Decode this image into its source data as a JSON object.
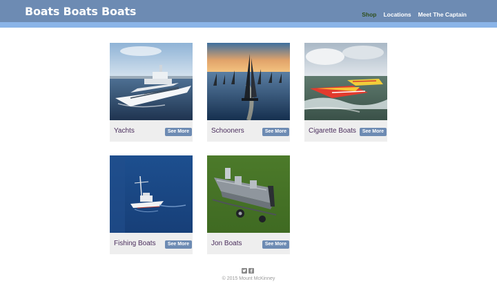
{
  "header": {
    "site_title": "Boats Boats Boats",
    "nav": [
      {
        "label": "Shop",
        "active": true
      },
      {
        "label": "Locations",
        "active": false
      },
      {
        "label": "Meet The Captain",
        "active": false
      }
    ]
  },
  "colors": {
    "header_bg": "#6d8bb3",
    "header_stripe": "#8ab4e8",
    "active_nav": "#2f4f1c",
    "button_bg": "#6d8bb3",
    "card_label": "#4a2d5c"
  },
  "products": [
    {
      "name": "Yachts",
      "button": "See More"
    },
    {
      "name": "Schooners",
      "button": "See More"
    },
    {
      "name": "Cigarette Boats",
      "button": "See More"
    },
    {
      "name": "Fishing Boats",
      "button": "See More"
    },
    {
      "name": "Jon Boats",
      "button": "See More"
    }
  ],
  "footer": {
    "social_icons": [
      "twitter-icon",
      "facebook-icon"
    ],
    "copyright": "© 2015 Mount McKinney"
  }
}
